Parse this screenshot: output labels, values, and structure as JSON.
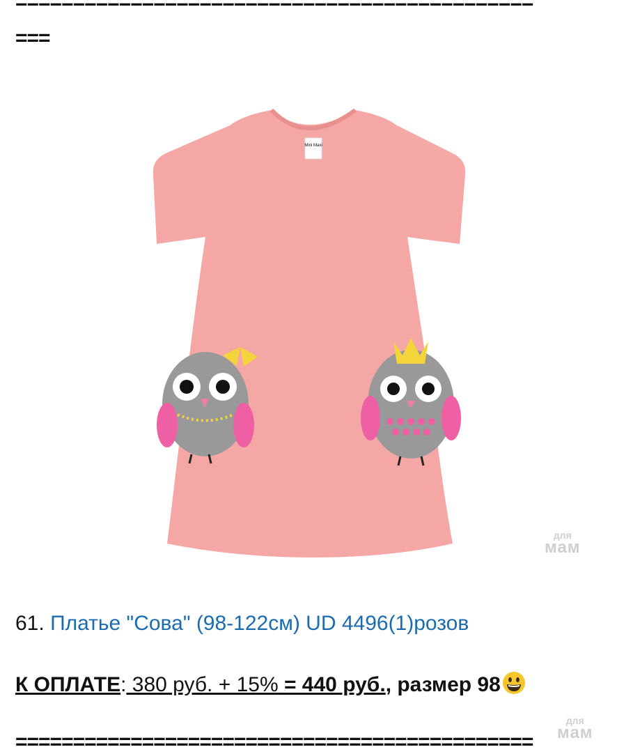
{
  "separators": {
    "top_line_1": "=============================================",
    "top_line_2": "===",
    "bottom_line": "============================================="
  },
  "watermark": {
    "small": "для",
    "big": "мам"
  },
  "item": {
    "number": "61.",
    "title": "Платье \"Сова\" (98-122см) UD 4496(1)розов",
    "link_color": "#1c6bb0"
  },
  "payment": {
    "label": "К ОПЛАТЕ",
    "colon": ":",
    "calc": " 380 руб. + 15% ",
    "total": "= 440 руб.",
    "size": ", размер 98",
    "emoji": "grinning-face-icon"
  },
  "dress": {
    "color": "#f4a7a4",
    "label_text": "Mini Maxi"
  }
}
